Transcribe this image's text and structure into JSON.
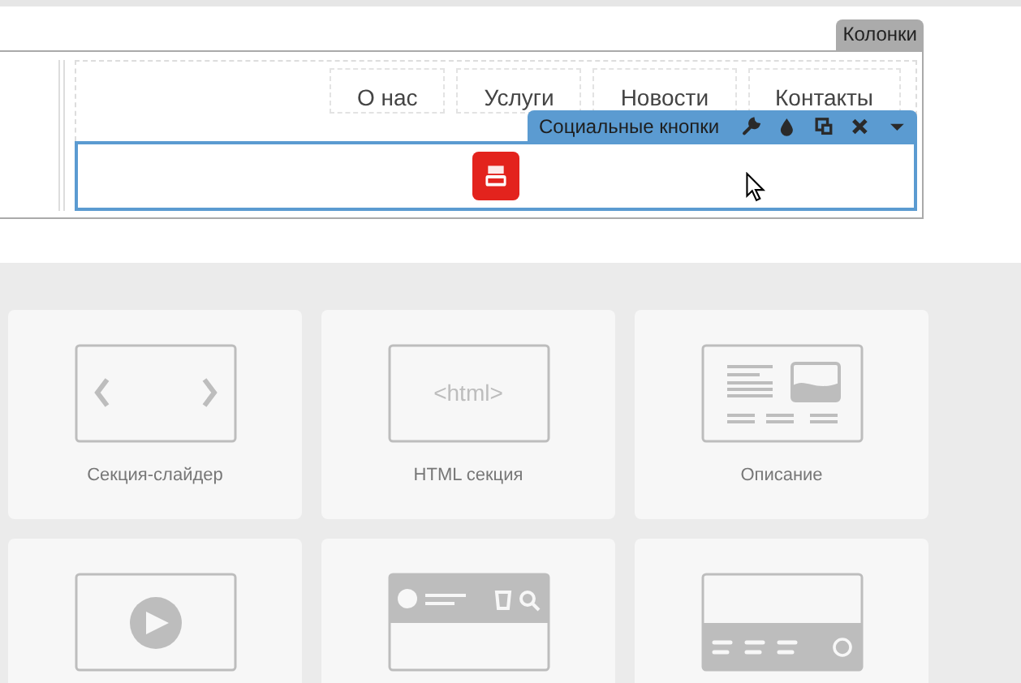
{
  "frame_tab": "Колонки",
  "menu": [
    {
      "label": "О нас"
    },
    {
      "label": "Услуги"
    },
    {
      "label": "Новости"
    },
    {
      "label": "Контакты"
    }
  ],
  "block_toolbar": {
    "title": "Социальные кнопки",
    "actions": [
      {
        "kind": "wrench"
      },
      {
        "kind": "drop"
      },
      {
        "kind": "copy"
      },
      {
        "kind": "close"
      },
      {
        "kind": "caret"
      }
    ]
  },
  "social_buttons": [
    {
      "kind": "youtube"
    }
  ],
  "templates": [
    {
      "kind": "slider",
      "label": "Секция-слайдер"
    },
    {
      "kind": "html",
      "label": "HTML секция",
      "thumb_text": "<html>"
    },
    {
      "kind": "description",
      "label": "Описание"
    },
    {
      "kind": "video"
    },
    {
      "kind": "header"
    },
    {
      "kind": "footer"
    }
  ]
}
